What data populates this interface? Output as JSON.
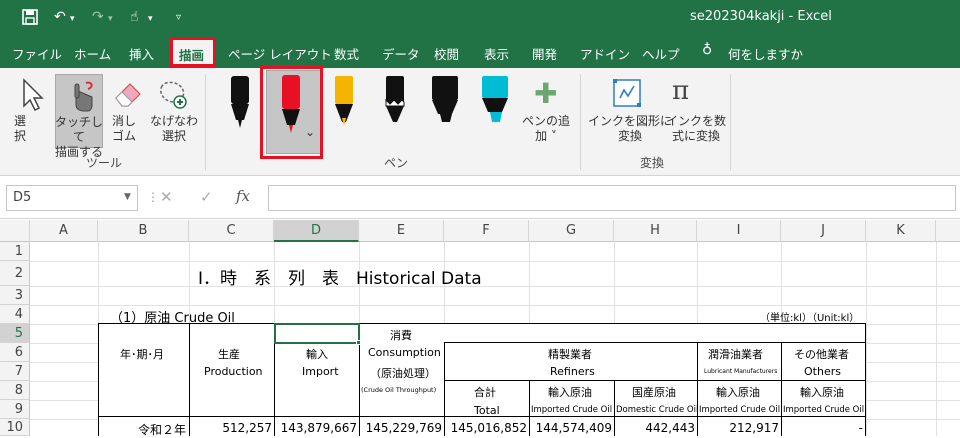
{
  "app": {
    "doc_title": "se202304kakji  -  Excel"
  },
  "tabs": [
    "ファイル",
    "ホーム",
    "挿入",
    "描画",
    "ページ レイアウト",
    "数式",
    "データ",
    "校閲",
    "表示",
    "開発",
    "アドイン",
    "ヘルプ"
  ],
  "tellme": "何をしますか",
  "ribbon": {
    "tools": {
      "select": "選\n択",
      "touch": "タッチして\n描画する",
      "eraser": "消し\nゴム",
      "lasso": "なげなわ\n選択",
      "group": "ツール"
    },
    "pens": {
      "add": "ペンの追\n加 ˅",
      "group": "ペン",
      "chevron": "⌄"
    },
    "convert": {
      "shape": "インクを図形に\n変換",
      "math": "インクを数\n式に変換",
      "group": "変換"
    }
  },
  "formula": {
    "namebox": "D5",
    "cancel": "✕",
    "enter": "✓",
    "fx": "fx"
  },
  "columns": [
    "A",
    "B",
    "C",
    "D",
    "E",
    "F",
    "G",
    "H",
    "I",
    "J",
    "K"
  ],
  "rows": [
    "1",
    "2",
    "3",
    "4",
    "5",
    "6",
    "7",
    "8",
    "9",
    "10"
  ],
  "sheet": {
    "title": "Ⅰ．時　系　列　表　Historical Data",
    "section": "（1）原油 Crude Oil",
    "unit": "（単位:kl）（Unit:kl）",
    "consumption_jp": "消費",
    "period": "年･期･月",
    "production_jp": "生産",
    "production_en": "Production",
    "import_jp": "輸入",
    "import_en": "Import",
    "consumption_en": "Consumption",
    "throughput_jp": "（原油処理）",
    "throughput_en": "(Crude Oil Throughput)",
    "refiners_jp": "精製業者",
    "refiners_en": "Refiners",
    "lubricant_jp": "潤滑油業者",
    "lubricant_en": "Lubricant Manufacturers",
    "others_jp": "その他業者",
    "others_en": "Others",
    "total_jp": "合計",
    "total_en": "Total",
    "imp_crude_jp": "輸入原油",
    "imp_crude_en": "Imported Crude Oil",
    "dom_crude_jp": "国産原油",
    "dom_crude_en": "Domestic Crude Oil",
    "lub_imp_jp": "輸入原油",
    "lub_imp_en": "Imported Crude Oil",
    "oth_imp_jp": "輸入原油",
    "oth_imp_en": "Imported Crude Oil",
    "row10": {
      "period": "令和２年",
      "production": "512,257",
      "import": "143,879,667",
      "consumption": "145,229,769",
      "total": "145,016,852",
      "imported": "144,574,409",
      "domestic": "442,443",
      "lubricant": "212,917",
      "others": "-"
    }
  },
  "colors": {
    "excel_green": "#217346",
    "highlight_red": "#e81123"
  }
}
